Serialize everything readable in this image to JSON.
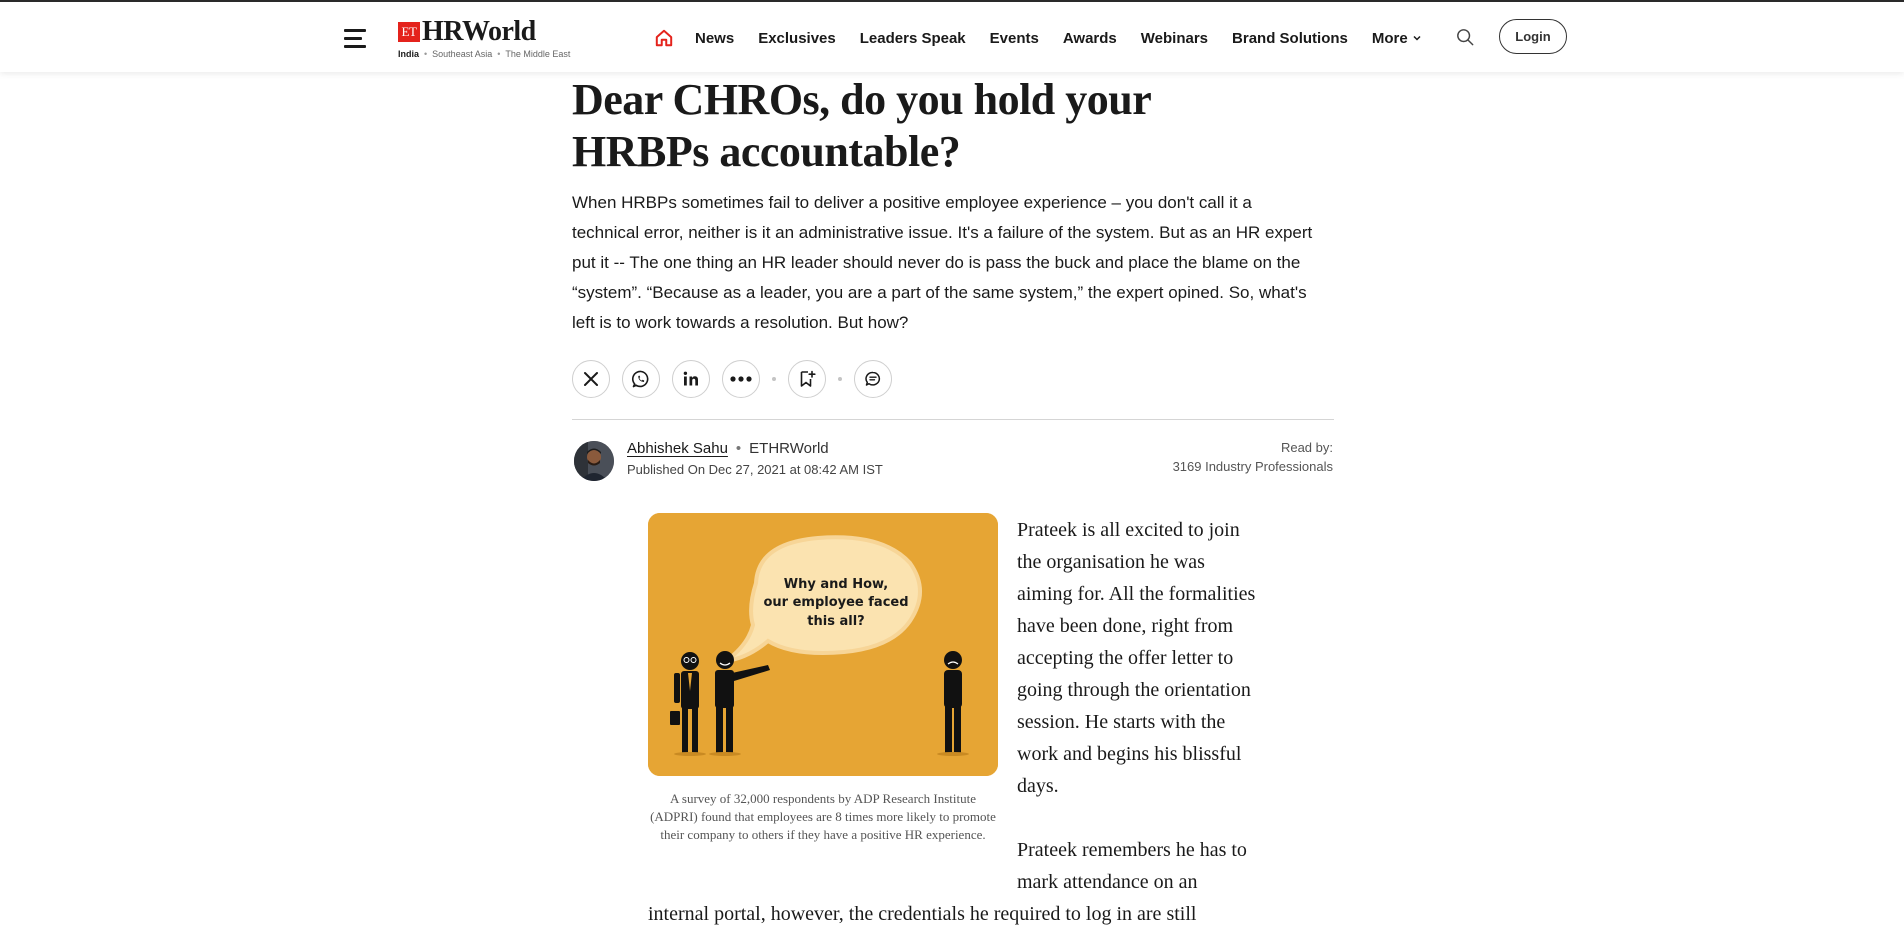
{
  "header": {
    "logo_et": "ET",
    "logo_brand": "HRWorld",
    "regions": [
      "India",
      "Southeast Asia",
      "The Middle East"
    ],
    "nav": [
      "News",
      "Exclusives",
      "Leaders Speak",
      "Events",
      "Awards",
      "Webinars",
      "Brand Solutions"
    ],
    "more_label": "More",
    "login_label": "Login",
    "home_icon_color": "#e4231c"
  },
  "article": {
    "title": "Dear CHROs, do you hold your HRBPs accountable?",
    "summary": "When HRBPs sometimes fail to deliver a positive employee experience – you don't call it a technical error, neither is it an administrative issue. It's a failure of the system. But as an HR expert put it -- The one thing an HR leader should never do is pass the buck and place the blame on the “system”. “Because as a leader, you are a part of the same system,” the expert opined. So, what's left is to work towards a resolution. But how?",
    "share_icons": [
      "x-icon",
      "whatsapp-icon",
      "linkedin-icon",
      "more-dots-icon",
      "bookmark-icon",
      "comment-icon"
    ],
    "author": {
      "name": "Abhishek Sahu",
      "source": "ETHRWorld",
      "published": "Published On Dec 27, 2021 at 08:42 AM IST"
    },
    "read_by_label": "Read by:",
    "read_by_count": "3169 Industry Professionals",
    "image": {
      "bubble_line1": "Why and How,",
      "bubble_line2": "our employee faced",
      "bubble_line3": "this all?",
      "background_color": "#e6a534"
    },
    "caption": "A survey of 32,000 respondents by ADP Research Institute (ADPRI) found that employees are 8 times more likely to promote their company to others if they have a positive HR experience.",
    "paragraph1": "Prateek is all excited to join the organisation he was aiming for. All the formalities have been done, right from accepting the offer letter to going through the orientation session. He starts with the work and begins his blissful days.",
    "paragraph2_part1": "Prateek remembers he has to mark attendance on an",
    "paragraph2_part2": "internal portal, however, the credentials he required to log in are still"
  }
}
